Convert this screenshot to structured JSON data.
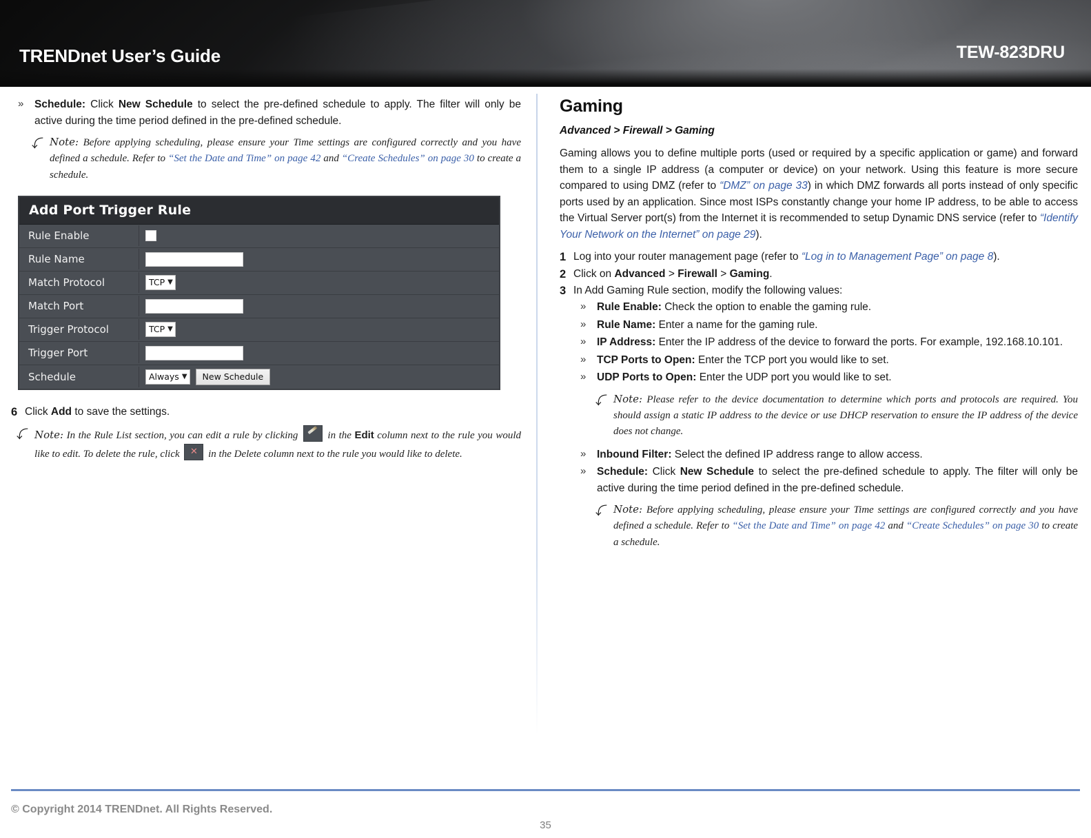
{
  "header": {
    "title": "TRENDnet User’s Guide",
    "model": "TEW-823DRU"
  },
  "left_column": {
    "schedule_bullet": {
      "label": "Schedule:",
      "text_1": " Click ",
      "strong_1": "New Schedule",
      "text_2": " to select the pre-defined schedule to apply. The filter will only be active during the time period defined in the pre-defined schedule."
    },
    "schedule_note": {
      "icon": "note-arrow-icon",
      "word": "Note:",
      "text_1": " Before applying scheduling, please ensure your Time settings are configured correctly and you have defined a schedule. Refer to ",
      "link_1": "“Set the Date and Time” on page 42",
      "text_2": " and ",
      "link_2": "“Create Schedules” on page 30",
      "text_3": " to create a schedule."
    },
    "router_ui": {
      "title": "Add Port Trigger Rule",
      "rows": [
        {
          "label": "Rule Enable",
          "control": "checkbox"
        },
        {
          "label": "Rule Name",
          "control": "text"
        },
        {
          "label": "Match Protocol",
          "control": "select",
          "value": "TCP"
        },
        {
          "label": "Match Port",
          "control": "text"
        },
        {
          "label": "Trigger Protocol",
          "control": "select",
          "value": "TCP"
        },
        {
          "label": "Trigger Port",
          "control": "text"
        },
        {
          "label": "Schedule",
          "control": "select_button",
          "value": "Always",
          "button": "New Schedule"
        }
      ]
    },
    "step6": {
      "num": "6",
      "text_1": "Click ",
      "strong_1": "Add",
      "text_2": " to save the settings."
    },
    "rule_list_note": {
      "icon": "note-arrow-icon",
      "word": "Note:",
      "text_1": " In the Rule List section, you can edit a rule by clicking ",
      "icon_edit": "pencil-icon",
      "text_2": " in the ",
      "strong_1": "Edit",
      "text_3": " column next to the rule you would like to edit. To delete the rule, click ",
      "icon_delete": "delete-x-icon",
      "text_4": " in the Delete column next to the rule you would like to delete."
    }
  },
  "right_column": {
    "section_title": "Gaming",
    "breadcrumb": "Advanced > Firewall > Gaming",
    "intro": {
      "text_1": "Gaming allows you to define multiple ports (used or required by a specific application or game) and forward them to a single IP address (a computer or device) on your network. Using this feature is more secure compared to using DMZ (refer to ",
      "link_1": "“DMZ” on page 33",
      "text_2": ") in which DMZ forwards all ports instead of only specific ports used by an application. Since most ISPs constantly change your home IP address, to be able to access the Virtual Server port(s) from the Internet it is recommended to setup Dynamic DNS service (refer to ",
      "link_2": "“Identify Your Network on the Internet” on page 29",
      "text_3": ")."
    },
    "steps": [
      {
        "num": "1",
        "text_1": "Log into your router management page (refer to ",
        "link_1": "“Log in to Management Page” on page 8",
        "text_2": ")."
      },
      {
        "num": "2",
        "text_1": "Click on ",
        "strong_1": "Advanced",
        "text_2": " > ",
        "strong_2": "Firewall",
        "text_3": " > ",
        "strong_3": "Gaming",
        "text_4": "."
      },
      {
        "num": "3",
        "text_1": "In Add Gaming Rule section, modify the following values:"
      }
    ],
    "bullets": [
      {
        "label": "Rule Enable:",
        "text": " Check the option to enable the gaming rule."
      },
      {
        "label": "Rule Name:",
        "text": " Enter a name for the gaming rule."
      },
      {
        "label": "IP Address:",
        "text": " Enter the IP address of the device to forward the ports. For example, 192.168.10.101."
      },
      {
        "label": "TCP Ports to Open:",
        "text": " Enter the TCP port you would like to set."
      },
      {
        "label": "UDP Ports to Open:",
        "text": " Enter the UDP port you would like to set."
      }
    ],
    "ports_note": {
      "icon": "note-arrow-icon",
      "word": "Note:",
      "text": " Please refer to the device documentation to determine which ports and protocols are required. You should assign a static IP address to the device or use DHCP reservation to ensure the IP address of the device does not change."
    },
    "bullets_2": [
      {
        "label": "Inbound Filter:",
        "text": " Select the defined IP address range to allow access."
      }
    ],
    "schedule_bullet": {
      "label": "Schedule:",
      "text_1": " Click ",
      "strong_1": "New Schedule",
      "text_2": " to select the pre-defined schedule to apply. The filter will only be active during the time period defined in the pre-defined schedule."
    },
    "schedule_note": {
      "icon": "note-arrow-icon",
      "word": "Note:",
      "text_1": " Before applying scheduling, please ensure your Time settings are configured correctly and you have defined a schedule. Refer to ",
      "link_1": "“Set the Date and Time” on page 42",
      "text_2": " and ",
      "link_2": "“Create Schedules” on page 30",
      "text_3": " to create a schedule."
    }
  },
  "footer": {
    "copyright": "© Copyright 2014 TRENDnet. All Rights Reserved.",
    "page_number": "35"
  },
  "colors": {
    "banner_bg": "#0b0b0b",
    "link": "#3a5fa8",
    "footer_rule": "#6a8bc4",
    "ui_panel": "#4a4e54",
    "ui_title_bar": "#2b2d31"
  }
}
